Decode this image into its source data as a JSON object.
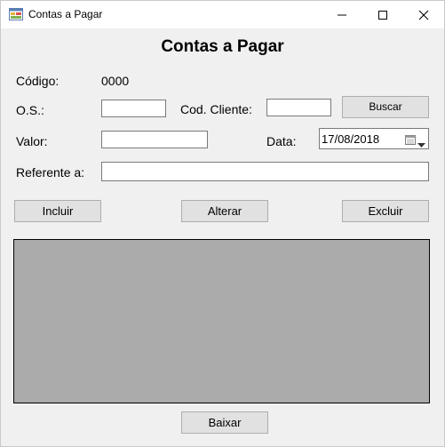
{
  "window": {
    "title": "Contas a Pagar"
  },
  "form": {
    "heading": "Contas a Pagar",
    "codigo_label": "Código:",
    "codigo_value": "0000",
    "os_label": "O.S.:",
    "os_value": "",
    "cod_cliente_label": "Cod. Cliente:",
    "cod_cliente_value": "",
    "buscar_label": "Buscar",
    "valor_label": "Valor:",
    "valor_value": "",
    "data_label": "Data:",
    "data_value": "17/08/2018",
    "referente_label": "Referente a:",
    "referente_value": ""
  },
  "actions": {
    "incluir": "Incluir",
    "alterar": "Alterar",
    "excluir": "Excluir",
    "baixar": "Baixar"
  },
  "icons": {
    "app": "form-app-icon",
    "minimize": "minimize-icon",
    "maximize": "maximize-icon",
    "close": "close-icon",
    "calendar": "calendar-icon",
    "dropdown": "chevron-down-icon"
  }
}
